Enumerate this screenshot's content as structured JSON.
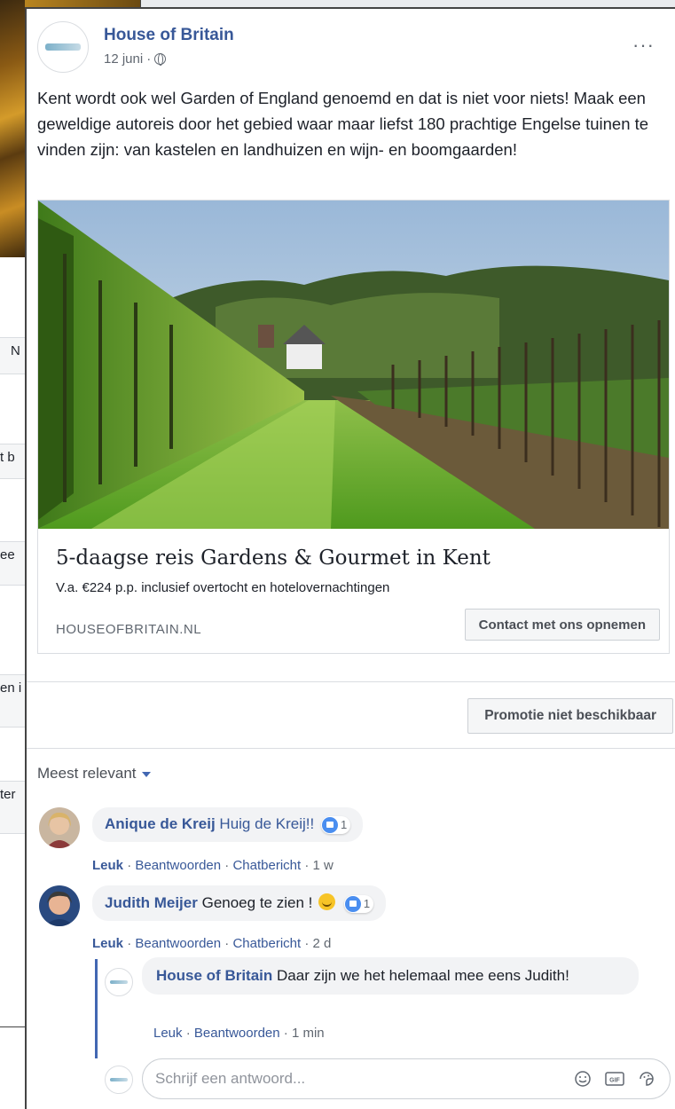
{
  "background_fragments": [
    "N",
    "t b",
    "ee",
    "en i",
    "ter"
  ],
  "post": {
    "page_name": "House of Britain",
    "date": "12 juni",
    "meta_separator": "·",
    "text": "Kent wordt ook wel Garden of England genoemd en dat is niet voor niets! Maak een geweldige autoreis door het gebied waar maar liefst 180 prachtige Engelse tuinen te vinden zijn: van kastelen en landhuizen en wijn- en boomgaarden!",
    "more_icon": "···"
  },
  "link": {
    "title": "5-daagse reis Gardens & Gourmet in Kent",
    "description": "V.a. €224 p.p. inclusief overtocht en hotelovernachtingen",
    "domain": "HOUSEOFBRITAIN.NL",
    "cta": "Contact met ons opnemen"
  },
  "promo_button": "Promotie niet beschikbaar",
  "sort_label": "Meest relevant",
  "comments": [
    {
      "author": "Anique de Kreij",
      "text": "Huig de Kreij!!",
      "likes": "1",
      "action_like": "Leuk",
      "action_reply": "Beantwoorden",
      "action_chat": "Chatbericht",
      "time": "1 w"
    },
    {
      "author": "Judith Meijer",
      "text": "Genoeg te zien !",
      "likes": "1",
      "action_like": "Leuk",
      "action_reply": "Beantwoorden",
      "action_chat": "Chatbericht",
      "time": "2 d"
    }
  ],
  "reply": {
    "author": "House of Britain",
    "text": "Daar zijn we het helemaal mee eens Judith!",
    "action_like": "Leuk",
    "action_reply": "Beantwoorden",
    "time": "1 min"
  },
  "reply_input": {
    "placeholder": "Schrijf een antwoord...",
    "icons": [
      "emoji-icon",
      "gif-icon",
      "sticker-icon"
    ],
    "gif_label": "GIF"
  },
  "separator": "·"
}
